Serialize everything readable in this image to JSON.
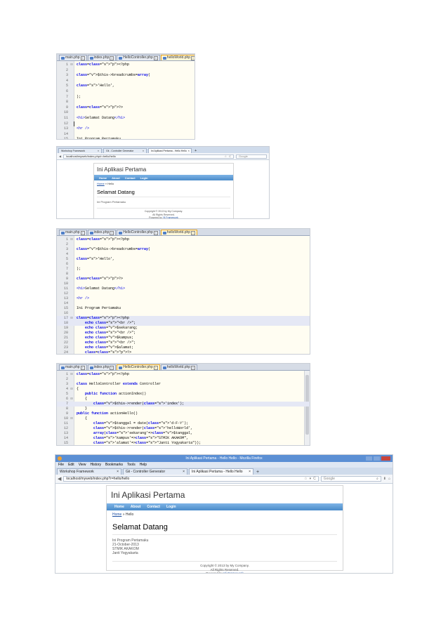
{
  "editor1": {
    "tabs": [
      {
        "label": "main.php",
        "active": false
      },
      {
        "label": "index.php",
        "active": false
      },
      {
        "label": "HelloController.php",
        "active": false
      },
      {
        "label": "helloWorld.php",
        "active": true
      }
    ],
    "lines": [
      {
        "num": "1",
        "text": "<?php",
        "fold": "⊟"
      },
      {
        "num": "2",
        "text": ""
      },
      {
        "num": "3",
        "text": "$this->breadcrumbs=array("
      },
      {
        "num": "4",
        "text": ""
      },
      {
        "num": "5",
        "text": "'Hello',"
      },
      {
        "num": "6",
        "text": ""
      },
      {
        "num": "7",
        "text": ");"
      },
      {
        "num": "8",
        "text": ""
      },
      {
        "num": "9",
        "text": "?>"
      },
      {
        "num": "10",
        "text": ""
      },
      {
        "num": "11",
        "text": "<h1>Selamat Datang</h1>"
      },
      {
        "num": "12",
        "text": "",
        "cur": true
      },
      {
        "num": "13",
        "text": "<hr />"
      },
      {
        "num": "14",
        "text": ""
      },
      {
        "num": "15",
        "text": "Ini Program Pertamaku"
      }
    ]
  },
  "browser1": {
    "tabs": [
      {
        "label": "Workshop Framework",
        "active": false
      },
      {
        "label": "Gii - Controller Generator",
        "active": false
      },
      {
        "label": "Ini Aplikasi Pertama - Hello Hello",
        "active": true
      }
    ],
    "url": "localhost/myweb/index.php/r=hello/hello",
    "search_placeholder": "Google",
    "site_title": "Ini Aplikasi Pertama",
    "menu": [
      "Home",
      "About",
      "Contact",
      "Login"
    ],
    "crumb_home": "Home",
    "crumb_sep": "»",
    "crumb_current": "Hello",
    "heading": "Selamat Datang",
    "body_lines": [
      "Ini Program Pertamaku"
    ],
    "footer": [
      "Copyright © 2013 by My Company.",
      "All Rights Reserved.",
      "Powered by"
    ],
    "footer_link": "Yii Framework"
  },
  "editor2": {
    "tabs": [
      {
        "label": "main.php",
        "active": false
      },
      {
        "label": "index.php",
        "active": false
      },
      {
        "label": "HelloController.php",
        "active": false
      },
      {
        "label": "helloWorld.php",
        "active": true
      }
    ],
    "lines": [
      {
        "num": "1",
        "text": "<?php",
        "fold": "⊟"
      },
      {
        "num": "2",
        "text": ""
      },
      {
        "num": "3",
        "text": "$this->breadcrumbs=array("
      },
      {
        "num": "4",
        "text": ""
      },
      {
        "num": "5",
        "text": "'Hello',"
      },
      {
        "num": "6",
        "text": ""
      },
      {
        "num": "7",
        "text": ");"
      },
      {
        "num": "8",
        "text": ""
      },
      {
        "num": "9",
        "text": "?>"
      },
      {
        "num": "10",
        "text": ""
      },
      {
        "num": "11",
        "text": "<h1>Selamat Datang</h1>"
      },
      {
        "num": "12",
        "text": ""
      },
      {
        "num": "13",
        "text": "<hr />"
      },
      {
        "num": "14",
        "text": ""
      },
      {
        "num": "15",
        "text": "Ini Program Pertamaku"
      },
      {
        "num": "16",
        "text": ""
      },
      {
        "num": "17",
        "text": "<?php",
        "fold": "⊟",
        "hl": true
      },
      {
        "num": "18",
        "text": "    echo \"<br />\";",
        "hl": true
      },
      {
        "num": "19",
        "text": "    echo $sekarang;"
      },
      {
        "num": "20",
        "text": "    echo \"<br />\";"
      },
      {
        "num": "21",
        "text": "    echo $kampus;"
      },
      {
        "num": "22",
        "text": "    echo \"<br />\";"
      },
      {
        "num": "23",
        "text": "    echo $alamat;"
      },
      {
        "num": "24",
        "text": "    ?>"
      }
    ]
  },
  "editor3": {
    "tabs": [
      {
        "label": "main.php",
        "active": false
      },
      {
        "label": "index.php",
        "active": false
      },
      {
        "label": "HelloController.php",
        "active": true
      },
      {
        "label": "helloWorld.php",
        "active": false
      }
    ],
    "lines": [
      {
        "num": "1",
        "text": "<?php",
        "fold": "⊟"
      },
      {
        "num": "2",
        "text": ""
      },
      {
        "num": "3",
        "text": "class HelloController extends Controller"
      },
      {
        "num": "4",
        "text": "{",
        "fold": "⊟"
      },
      {
        "num": "5",
        "text": "    public function actionIndex()"
      },
      {
        "num": "6",
        "text": "    {",
        "fold": "⊟"
      },
      {
        "num": "7",
        "text": "        $this->render('index');",
        "hl": true
      },
      {
        "num": "8",
        "text": "    }"
      },
      {
        "num": "9",
        "text": "public function actionHello()"
      },
      {
        "num": "10",
        "text": "    {",
        "fold": "⊟"
      },
      {
        "num": "11",
        "text": "        $tanggal = date('d-F-Y');"
      },
      {
        "num": "12",
        "text": "        $this->render('helloWorld',"
      },
      {
        "num": "13",
        "text": "        array('sekarang'=>$tanggal,"
      },
      {
        "num": "14",
        "text": "        'kampus'=>\"STMIK AKAKOM\","
      },
      {
        "num": "15",
        "text": "        'alamat'=>\"Janti Yogyakarta\"));"
      }
    ]
  },
  "browser2": {
    "window_title": "Ini Aplikasi Pertama - Hello Hello - Mozilla Firefox",
    "menubar": [
      "File",
      "Edit",
      "View",
      "History",
      "Bookmarks",
      "Tools",
      "Help"
    ],
    "tabs": [
      {
        "label": "Workshop Framework",
        "active": false
      },
      {
        "label": "Gii - Controller Generator",
        "active": false
      },
      {
        "label": "Ini Aplikasi Pertama - Hello Hello",
        "active": true
      }
    ],
    "url": "localhost/myweb/index.php?r=hello/hello",
    "search_placeholder": "Google",
    "site_title": "Ini Aplikasi Pertama",
    "menu": [
      "Home",
      "About",
      "Contact",
      "Login"
    ],
    "crumb_home": "Home",
    "crumb_sep": "»",
    "crumb_current": "Hello",
    "heading": "Selamat Datang",
    "body_lines": [
      "Ini Program Pertamaku",
      "21-October-2013",
      "STMIK AKAKOM",
      "Janti Yogyakarta"
    ],
    "footer": [
      "Copyright © 2013 by My Company.",
      "All Rights Reserved.",
      "Powered by"
    ],
    "footer_link": "Yii Framework"
  },
  "colors": {
    "titlebar": "#5b8fd4",
    "menu_gradient_top": "#7eb4e6",
    "menu_gradient_bottom": "#4a8bc9",
    "link": "#1e50a2",
    "editor_bg": "#fffdf2",
    "active_tab_border": "#e6a420"
  }
}
